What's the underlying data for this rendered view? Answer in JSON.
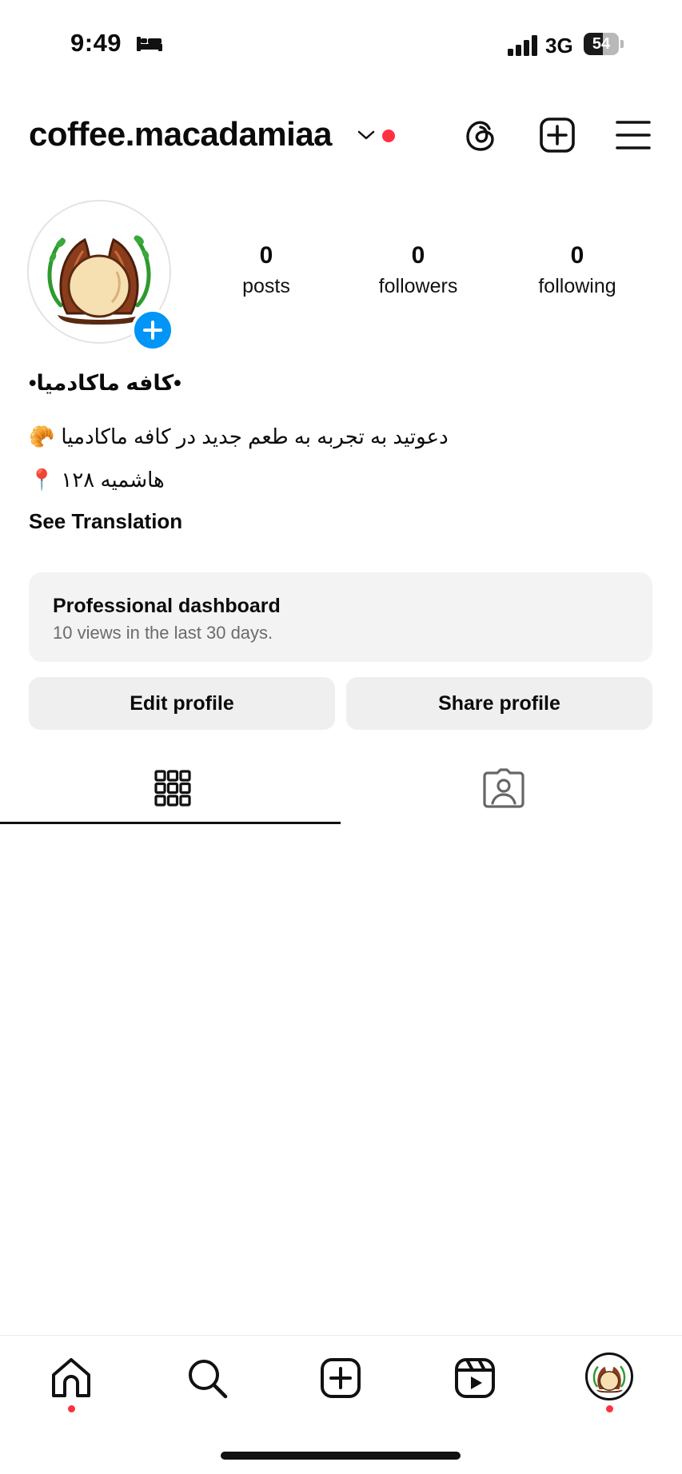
{
  "status_bar": {
    "time": "9:49",
    "network": "3G",
    "battery": "54",
    "battery_level": 0.54,
    "icons": [
      "bed-icon",
      "signal-icon",
      "battery-icon"
    ]
  },
  "header": {
    "username": "coffee.macadamiaa",
    "icons": [
      "chevron-down-icon",
      "notification-dot",
      "threads-icon",
      "create-icon",
      "menu-icon"
    ],
    "accent_color": "#ff3040"
  },
  "profile": {
    "avatar_icon": "macadamia-logo",
    "stats": [
      {
        "value": "0",
        "label": "posts"
      },
      {
        "value": "0",
        "label": "followers"
      },
      {
        "value": "0",
        "label": "following"
      }
    ],
    "name": "•کافه ماکادمیا•",
    "bio_lines": [
      {
        "emoji": "🥐",
        "text": "دعوتید به تجربه به طعم جدید در کافه ماکادمیا"
      },
      {
        "emoji": "📍",
        "text": "هاشمیه ۱۲۸"
      }
    ],
    "see_translation": "See Translation"
  },
  "dashboard": {
    "title": "Professional dashboard",
    "subtitle": "10 views in the last 30 days."
  },
  "buttons": {
    "edit": "Edit profile",
    "share": "Share profile"
  },
  "tabs": {
    "active": "grid",
    "items": [
      "grid-icon",
      "tagged-icon"
    ]
  },
  "bottom_nav": {
    "items": [
      "home-icon",
      "search-icon",
      "create-icon",
      "reels-icon",
      "profile-avatar"
    ],
    "active": "profile",
    "dot_color": "#ff3040"
  },
  "colors": {
    "primary_blue": "#0095f6",
    "button_bg": "#efefef",
    "dashboard_bg": "#f3f3f3"
  }
}
